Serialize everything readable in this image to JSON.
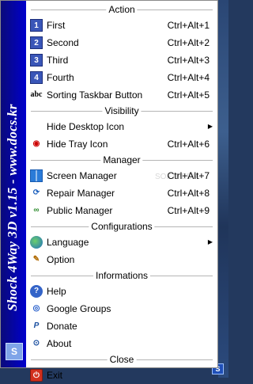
{
  "sidebar": {
    "title": "Shock 4Way 3D v1.15 - www.docs.kr",
    "logo": "S"
  },
  "sections": [
    {
      "label": "Action",
      "items": [
        {
          "icon": "number-1-icon",
          "glyph": "1",
          "label": "First",
          "shortcut": "Ctrl+Alt+1"
        },
        {
          "icon": "number-2-icon",
          "glyph": "2",
          "label": "Second",
          "shortcut": "Ctrl+Alt+2"
        },
        {
          "icon": "number-3-icon",
          "glyph": "3",
          "label": "Third",
          "shortcut": "Ctrl+Alt+3"
        },
        {
          "icon": "number-4-icon",
          "glyph": "4",
          "label": "Fourth",
          "shortcut": "Ctrl+Alt+4"
        },
        {
          "icon": "abc-sort-icon",
          "glyph": "abc",
          "label": "Sorting Taskbar Button",
          "shortcut": "Ctrl+Alt+5"
        }
      ]
    },
    {
      "label": "Visibility",
      "items": [
        {
          "icon": "",
          "glyph": "",
          "label": "Hide Desktop Icon",
          "shortcut": "",
          "submenu": true
        },
        {
          "icon": "eye-icon",
          "glyph": "◉",
          "label": "Hide Tray Icon",
          "shortcut": "Ctrl+Alt+6"
        }
      ]
    },
    {
      "label": "Manager",
      "items": [
        {
          "icon": "windows-icon",
          "glyph": "",
          "label": "Screen Manager",
          "shortcut": "Ctrl+Alt+7"
        },
        {
          "icon": "repair-icon",
          "glyph": "⟳",
          "label": "Repair Manager",
          "shortcut": "Ctrl+Alt+8"
        },
        {
          "icon": "chain-link-icon",
          "glyph": "∞",
          "label": "Public Manager",
          "shortcut": "Ctrl+Alt+9"
        }
      ]
    },
    {
      "label": "Configurations",
      "items": [
        {
          "icon": "globe-icon",
          "glyph": "",
          "label": "Language",
          "shortcut": "",
          "submenu": true
        },
        {
          "icon": "option-icon",
          "glyph": "✎",
          "label": "Option",
          "shortcut": ""
        }
      ]
    },
    {
      "label": "Informations",
      "items": [
        {
          "icon": "help-icon",
          "glyph": "?",
          "label": "Help",
          "shortcut": ""
        },
        {
          "icon": "google-groups-icon",
          "glyph": "◎",
          "label": "Google Groups",
          "shortcut": ""
        },
        {
          "icon": "paypal-icon",
          "glyph": "P",
          "label": "Donate",
          "shortcut": ""
        },
        {
          "icon": "about-icon",
          "glyph": "⊙",
          "label": "About",
          "shortcut": ""
        }
      ]
    },
    {
      "label": "Close",
      "items": [
        {
          "icon": "exit-icon",
          "glyph": "⏻",
          "label": "Exit",
          "shortcut": ""
        }
      ]
    }
  ],
  "watermark": "SOFTPEDIA",
  "tray": {
    "glyph": "S"
  }
}
